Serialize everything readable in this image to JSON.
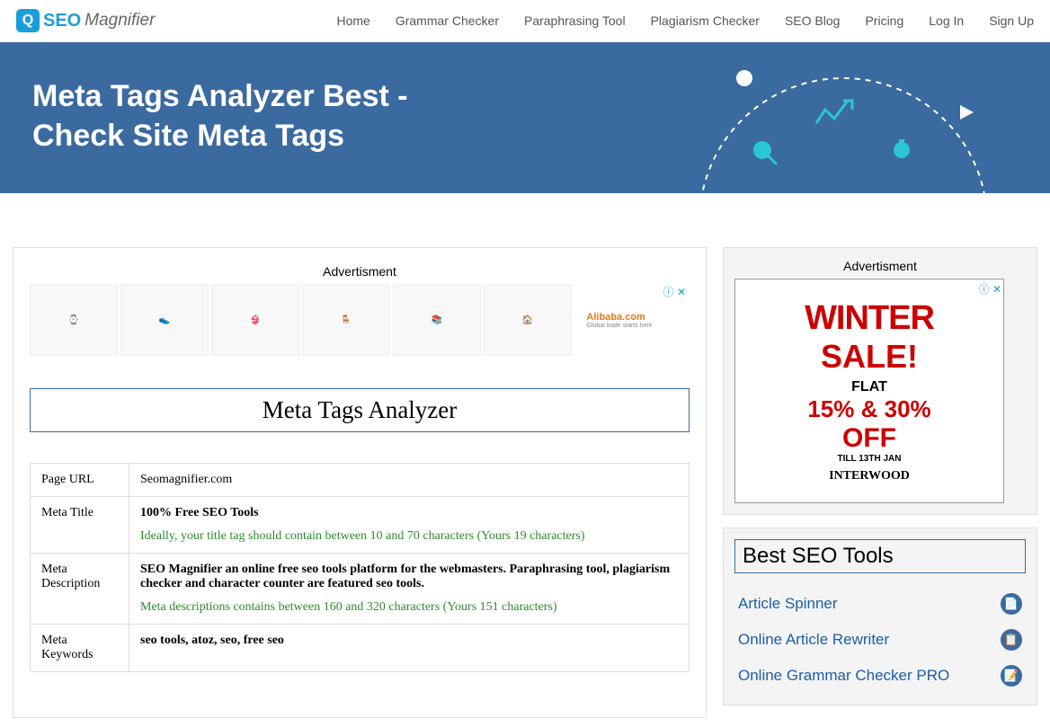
{
  "logo": {
    "part1": "SEO",
    "part2": "Magnifier"
  },
  "nav": [
    "Home",
    "Grammar Checker",
    "Paraphrasing Tool",
    "Plagiarism Checker",
    "SEO Blog",
    "Pricing",
    "Log In",
    "Sign Up"
  ],
  "hero_title": "Meta Tags Analyzer Best - Check Site Meta Tags",
  "ad_label": "Advertisment",
  "ad_brand": "Alibaba.com",
  "ad_tagline": "Global trade starts here",
  "tool_heading": "Meta Tags Analyzer",
  "results": {
    "rows": [
      {
        "label": "Page URL",
        "value": "Seomagnifier.com",
        "hint": ""
      },
      {
        "label": "Meta Title",
        "value": "100% Free SEO Tools",
        "hint": "Ideally, your title tag should contain between 10 and 70 characters (Yours 19 characters)"
      },
      {
        "label": "Meta Description",
        "value": "SEO Magnifier an online free seo tools platform for the webmasters. Paraphrasing tool, plagiarism checker and character counter are featured seo tools.",
        "hint": "Meta descriptions contains between 160 and 320 characters (Yours 151 characters)"
      },
      {
        "label": "Meta Keywords",
        "value": "seo tools, atoz, seo, free seo",
        "hint": ""
      }
    ]
  },
  "side_ad": {
    "line1": "WINTER",
    "line2": "SALE!",
    "flat": "FLAT",
    "pct": "15% & 30%",
    "off": "OFF",
    "till": "TILL 13TH JAN",
    "brand": "INTERWOOD"
  },
  "best_tools_title": "Best SEO Tools",
  "best_tools": [
    "Article Spinner",
    "Online Article Rewriter",
    "Online Grammar Checker PRO"
  ]
}
